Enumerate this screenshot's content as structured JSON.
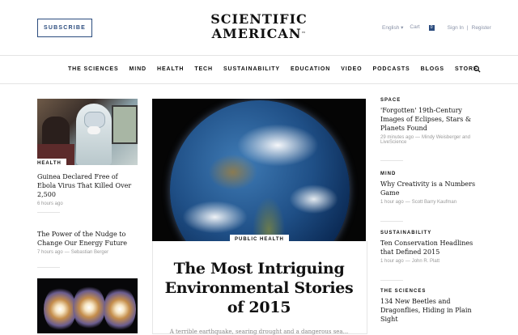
{
  "header": {
    "subscribe_label": "SUBSCRIBE",
    "logo_line1": "SCIENTIFIC",
    "logo_line2": "AMERICAN",
    "logo_tm": "™",
    "language": "English ▾",
    "cart_label": "Cart",
    "cart_count": "0",
    "sign_in": "Sign In",
    "separator": "|",
    "register": "Register"
  },
  "nav": {
    "items": [
      "THE SCIENCES",
      "MIND",
      "HEALTH",
      "TECH",
      "SUSTAINABILITY",
      "EDUCATION",
      "VIDEO",
      "PODCASTS",
      "BLOGS",
      "STORE"
    ]
  },
  "left": {
    "story1": {
      "tag": "HEALTH",
      "headline": "Guinea Declared Free of Ebola Virus That Killed Over 2,500",
      "time": "6 hours ago"
    },
    "story2": {
      "headline": "The Power of the Nudge to Change Our Energy Future",
      "time": "7 hours ago",
      "author_sep": "—",
      "author": "Sebastian Berger"
    }
  },
  "hero": {
    "tag": "PUBLIC HEALTH",
    "title": "The Most Intriguing Environmental Stories of 2015",
    "dek": "A terrible earthquake, searing drought and a dangerous sea..."
  },
  "right": {
    "story1": {
      "kicker": "SPACE",
      "headline": "'Forgotten' 19th-Century Images of Eclipses, Stars & Planets Found",
      "time": "29 minutes ago",
      "author_sep": "—",
      "author": "Mindy Weisberger and LiveScience"
    },
    "story2": {
      "kicker": "MIND",
      "headline": "Why Creativity is a Numbers Game",
      "time": "1 hour ago",
      "author_sep": "—",
      "author": "Scott Barry Kaufman"
    },
    "story3": {
      "kicker": "SUSTAINABILITY",
      "headline": "Ten Conservation Headlines that Defined 2015",
      "time": "1 hour ago",
      "author_sep": "—",
      "author": "John R. Platt"
    },
    "story4": {
      "kicker": "THE SCIENCES",
      "headline": "134 New Beetles and Dragonflies, Hiding in Plain Sight"
    }
  },
  "colors": {
    "brand_blue": "#2b4c7e",
    "meta_gray": "#9a9a9a",
    "divider": "#e4e4e4"
  },
  "icons": [
    "search-icon"
  ]
}
